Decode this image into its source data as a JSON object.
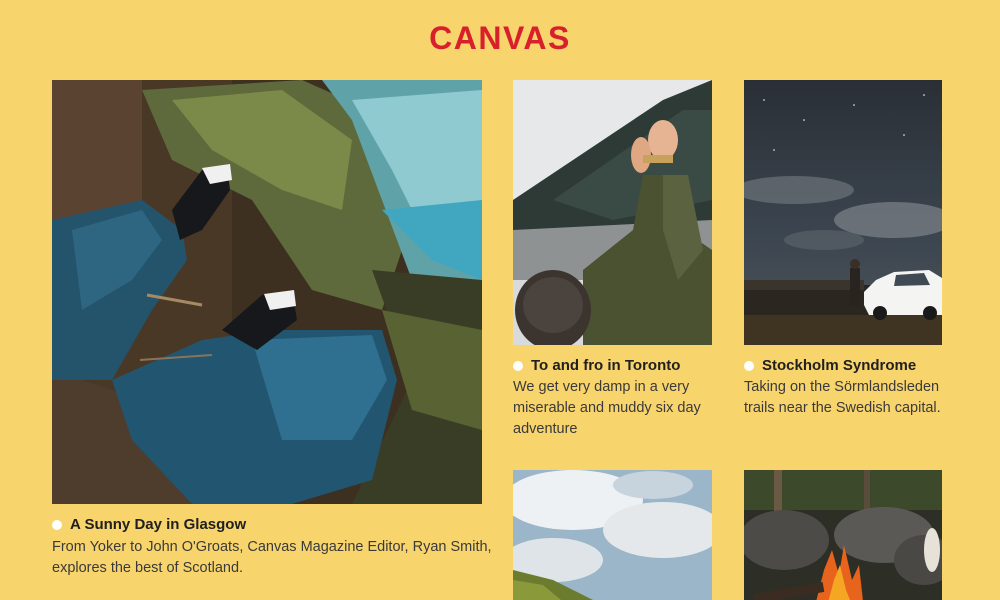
{
  "brand": {
    "logo_text": "CANVAS",
    "accent_color": "#d8202c",
    "background_color": "#f8d46c"
  },
  "articles": [
    {
      "headline": "A Sunny Day in Glasgow",
      "excerpt": "From Yoker to John O'Groats, Canvas Magazine Editor, Ryan Smith, explores the best of Scotland.",
      "image": "sneakers-over-river-photo"
    },
    {
      "headline": "To and fro in Toronto",
      "excerpt": "We get very damp in a very miserable and muddy six day adventure",
      "image": "tent-pitching-photo"
    },
    {
      "headline": "Stockholm Syndrome",
      "excerpt": "Taking on the Sörmlandsleden trails near the Swedish capital.",
      "image": "night-sky-car-photo"
    },
    {
      "image": "cloudy-sky-hill-photo"
    },
    {
      "image": "campfire-photo"
    }
  ]
}
